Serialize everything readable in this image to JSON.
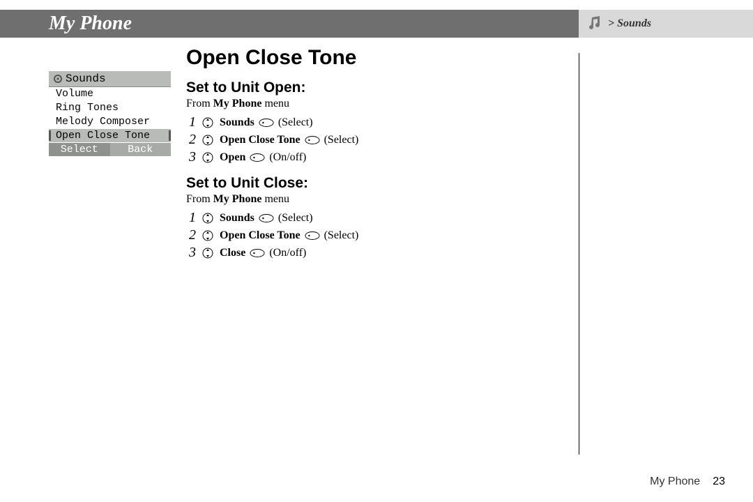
{
  "header": {
    "title": "My Phone",
    "breadcrumb": "> Sounds"
  },
  "phone_screen": {
    "title": "Sounds",
    "items": [
      "Volume",
      "Ring Tones",
      "Melody Composer",
      "Open Close Tone"
    ],
    "selected_index": 3,
    "softkeys": {
      "left": "Select",
      "right": "Back"
    }
  },
  "page": {
    "title": "Open Close Tone",
    "sections": [
      {
        "heading": "Set to Unit Open:",
        "from_prefix": "From ",
        "from_bold": "My Phone",
        "from_suffix": " menu",
        "steps": [
          {
            "num": "1",
            "bold": "Sounds",
            "paren": "(Select)"
          },
          {
            "num": "2",
            "bold": "Open Close Tone",
            "paren": "(Select)"
          },
          {
            "num": "3",
            "bold": "Open",
            "paren": "(On/off)"
          }
        ]
      },
      {
        "heading": "Set to Unit Close:",
        "from_prefix": "From ",
        "from_bold": "My Phone",
        "from_suffix": " menu",
        "steps": [
          {
            "num": "1",
            "bold": "Sounds",
            "paren": "(Select)"
          },
          {
            "num": "2",
            "bold": "Open Close Tone",
            "paren": "(Select)"
          },
          {
            "num": "3",
            "bold": "Close",
            "paren": "(On/off)"
          }
        ]
      }
    ]
  },
  "footer": {
    "section": "My Phone",
    "page_number": "23"
  }
}
